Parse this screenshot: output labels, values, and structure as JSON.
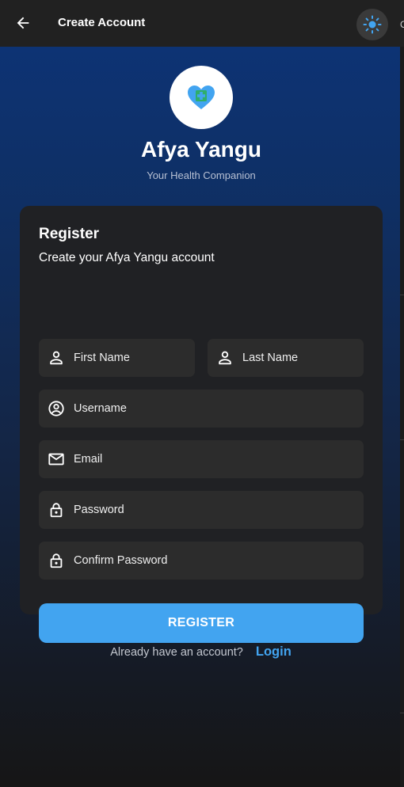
{
  "appbar": {
    "title": "Create Account",
    "back_icon": "arrow-left-icon",
    "theme_icon": "sun-icon",
    "edge_char": "C"
  },
  "brand": {
    "name": "Afya Yangu",
    "tagline": "Your Health Companion",
    "logo_icon": "heart-medical-icon"
  },
  "form": {
    "title": "Register",
    "subtitle": "Create your Afya Yangu account",
    "first_name": {
      "placeholder": "First Name",
      "value": "",
      "icon": "person-icon"
    },
    "last_name": {
      "placeholder": "Last Name",
      "value": "",
      "icon": "person-icon"
    },
    "username": {
      "placeholder": "Username",
      "value": "",
      "icon": "account-circle-icon"
    },
    "email": {
      "placeholder": "Email",
      "value": "",
      "icon": "mail-icon"
    },
    "password": {
      "placeholder": "Password",
      "value": "",
      "icon": "lock-icon"
    },
    "confirm_password": {
      "placeholder": "Confirm Password",
      "value": "",
      "icon": "lock-icon"
    },
    "submit_label": "REGISTER"
  },
  "footer": {
    "prompt": "Already have an account?",
    "login_label": "Login"
  },
  "colors": {
    "accent": "#42a4f0",
    "card": "#202124",
    "field": "#2c2c2c",
    "gradient_top": "#0d3374"
  }
}
